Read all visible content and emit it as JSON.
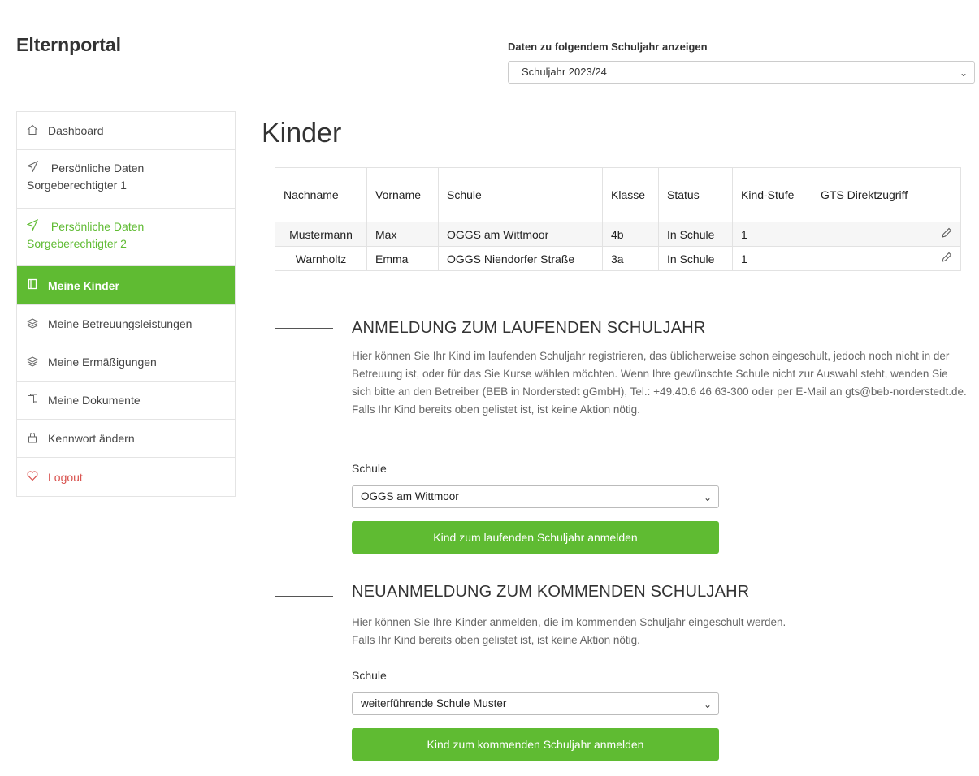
{
  "brand": "Elternportal",
  "year_selector": {
    "label": "Daten zu folgendem Schuljahr anzeigen",
    "value": "Schuljahr 2023/24"
  },
  "sidebar": {
    "items": [
      {
        "label": "Dashboard",
        "icon": "home-icon"
      },
      {
        "label": "Persönliche Daten Sorgeberechtigter 1",
        "icon": "send-icon"
      },
      {
        "label": "Persönliche Daten Sorgeberechtigter 2",
        "icon": "send-icon",
        "color": "#5fbb32"
      },
      {
        "label": "Meine Kinder",
        "icon": "book-icon",
        "active": true
      },
      {
        "label": "Meine Betreuungsleistungen",
        "icon": "layers-icon"
      },
      {
        "label": "Meine Ermäßigungen",
        "icon": "layers-icon"
      },
      {
        "label": "Meine Dokumente",
        "icon": "documents-icon"
      },
      {
        "label": "Kennwort ändern",
        "icon": "lock-icon"
      },
      {
        "label": "Logout",
        "icon": "heart-icon",
        "color": "#d9534f"
      }
    ]
  },
  "page_title": "Kinder",
  "table": {
    "headers": [
      "Nachname",
      "Vorname",
      "Schule",
      "Klasse",
      "Status",
      "Kind-Stufe",
      "GTS Direktzugriff",
      ""
    ],
    "rows": [
      [
        "Mustermann",
        "Max",
        "OGGS am Wittmoor",
        "4b",
        "In Schule",
        "1",
        "",
        ""
      ],
      [
        "Warnholtz",
        "Emma",
        "OGGS Niendorfer Straße",
        "3a",
        "In Schule",
        "1",
        "",
        ""
      ]
    ]
  },
  "section_current": {
    "title": "ANMELDUNG ZUM LAUFENDEN SCHULJAHR",
    "text": "Hier können Sie Ihr Kind im laufenden Schuljahr registrieren, das üblicherweise schon eingeschult, jedoch noch nicht in der Betreuung ist, oder für das Sie Kurse wählen möchten. Wenn Ihre gewünschte Schule nicht zur Auswahl steht, wenden Sie sich bitte an den Betreiber (BEB in Norderstedt gGmbH), Tel.: +49.40.6 46 63-300 oder per E-Mail an gts@beb-norderstedt.de.",
    "note": "Falls Ihr Kind bereits oben gelistet ist, ist keine Aktion nötig.",
    "school_label": "Schule",
    "school_value": "OGGS am Wittmoor",
    "button": "Kind zum laufenden Schuljahr anmelden"
  },
  "section_next": {
    "title": "NEUANMELDUNG ZUM KOMMENDEN SCHULJAHR",
    "text": "Hier können Sie Ihre Kinder anmelden, die im kommenden Schuljahr eingeschult werden.",
    "note": "Falls Ihr Kind bereits oben gelistet ist, ist keine Aktion nötig.",
    "school_label": "Schule",
    "school_value": "weiterführende Schule Muster",
    "button": "Kind zum kommenden Schuljahr anmelden"
  },
  "colors": {
    "accent": "#5fbb32",
    "logout": "#d9534f"
  }
}
